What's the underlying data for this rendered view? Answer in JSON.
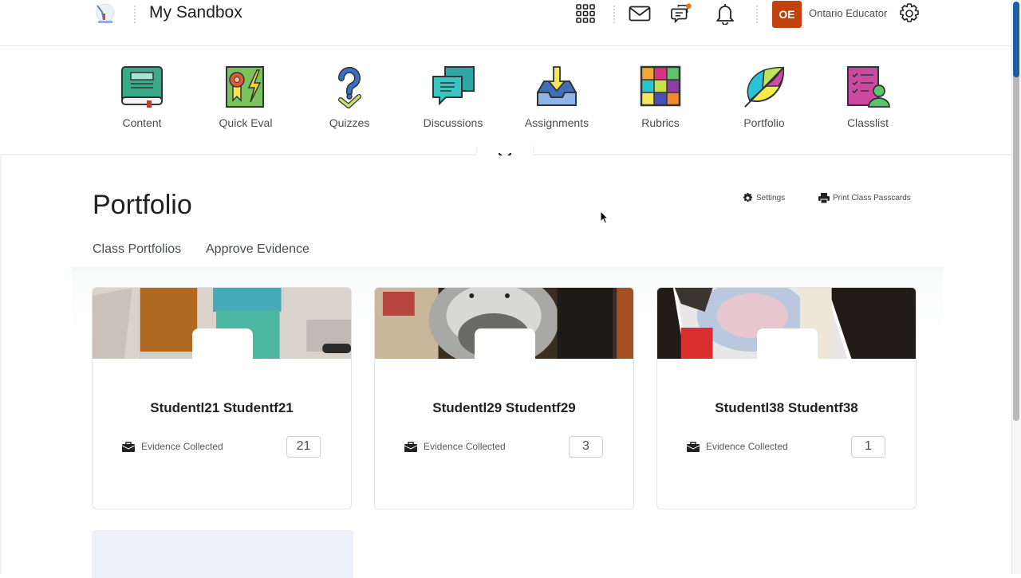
{
  "header": {
    "course_title": "My Sandbox",
    "user_initials": "OE",
    "user_name": "Ontario Educator",
    "icons": [
      "apps-grid-icon",
      "mail-icon",
      "chat-icon",
      "bell-icon",
      "gear-icon"
    ],
    "avatar_color": "#c2410c"
  },
  "navbar": {
    "items": [
      {
        "label": "Content",
        "icon": "book-icon"
      },
      {
        "label": "Quick Eval",
        "icon": "ribbon-lightning-icon"
      },
      {
        "label": "Quizzes",
        "icon": "question-check-icon"
      },
      {
        "label": "Discussions",
        "icon": "speech-bubbles-icon"
      },
      {
        "label": "Assignments",
        "icon": "inbox-download-icon"
      },
      {
        "label": "Rubrics",
        "icon": "color-grid-icon"
      },
      {
        "label": "Portfolio",
        "icon": "leaf-icon"
      },
      {
        "label": "Classlist",
        "icon": "checklist-person-icon"
      }
    ]
  },
  "page": {
    "title": "Portfolio",
    "actions": {
      "settings": "Settings",
      "print": "Print Class Passcards"
    },
    "tabs": [
      {
        "label": "Class Portfolios"
      },
      {
        "label": "Approve Evidence"
      }
    ]
  },
  "cards": [
    {
      "name": "Studentl21 Studentf21",
      "evidence_label": "Evidence Collected",
      "count": "21"
    },
    {
      "name": "Studentl29 Studentf29",
      "evidence_label": "Evidence Collected",
      "count": "3"
    },
    {
      "name": "Studentl38 Studentf38",
      "evidence_label": "Evidence Collected",
      "count": "1"
    }
  ]
}
